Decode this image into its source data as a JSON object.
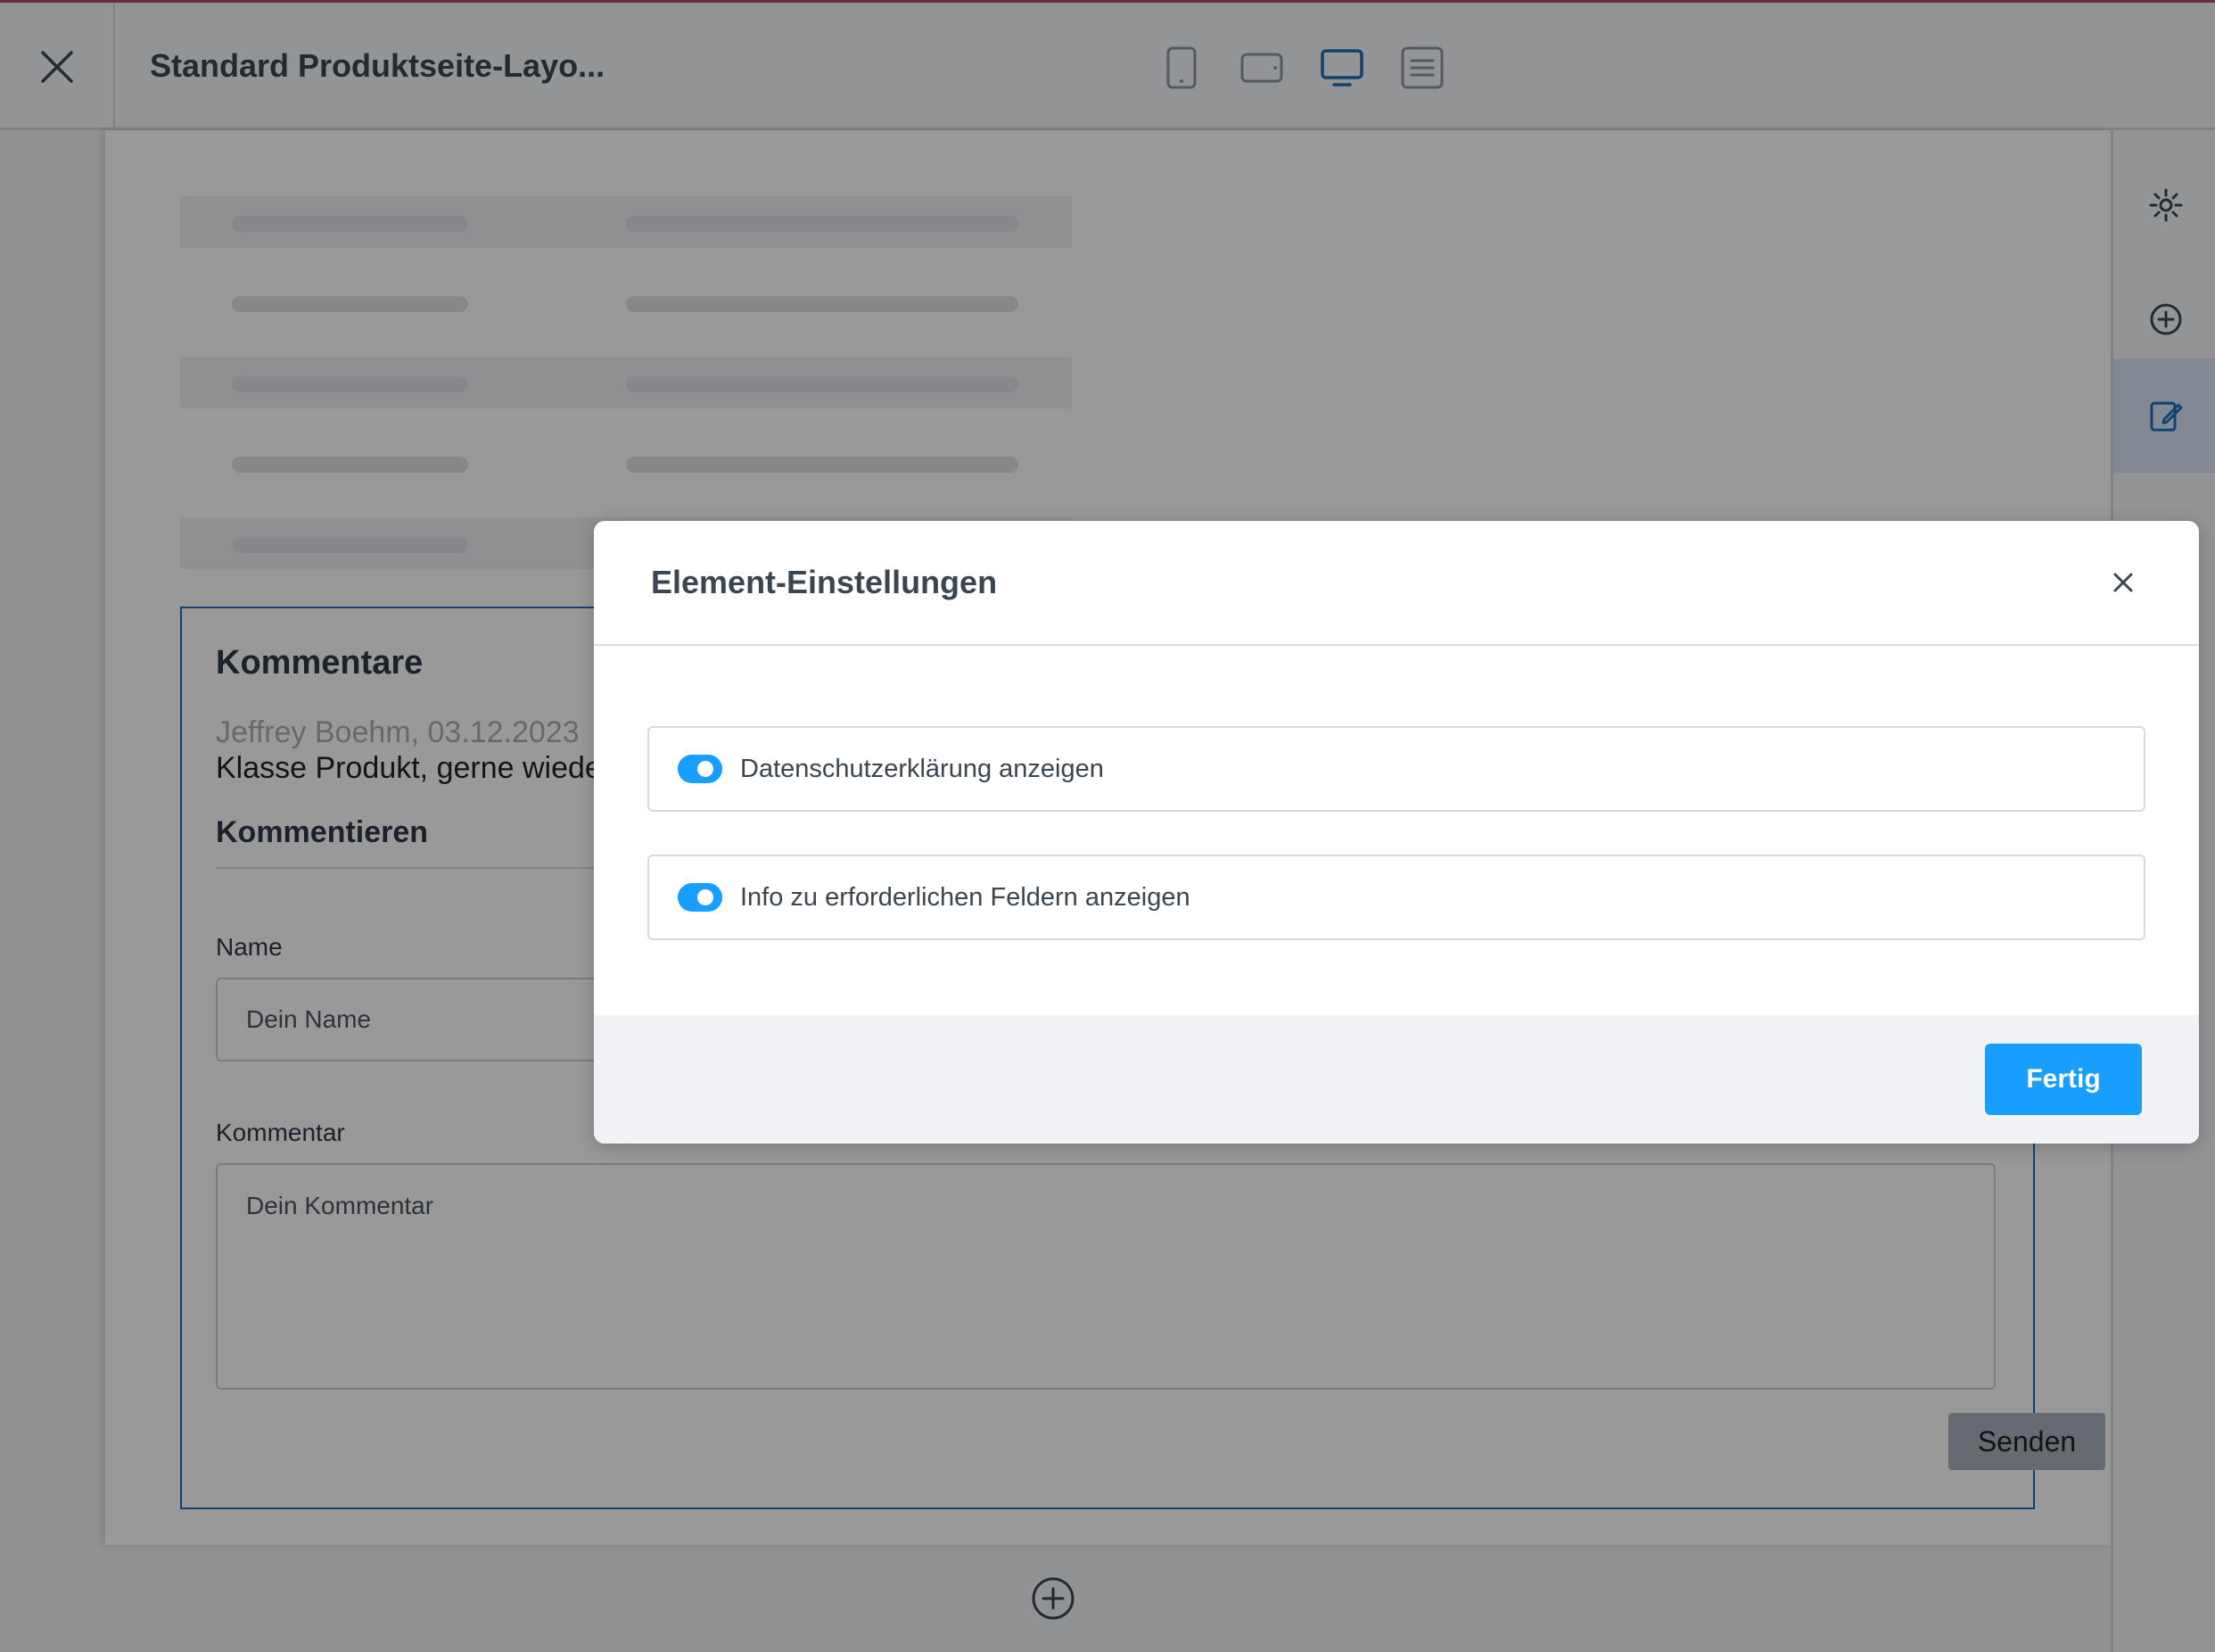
{
  "topbar": {
    "title": "Standard Produktseite-Layo..."
  },
  "view_modes": [
    "mobile",
    "tablet",
    "desktop",
    "list"
  ],
  "comments": {
    "title": "Kommentare",
    "meta": "Jeffrey Boehm, 03.12.2023",
    "text": "Klasse Produkt, gerne wiede",
    "subheading": "Kommentieren",
    "name_label": "Name",
    "name_placeholder": "Dein Name",
    "comment_label": "Kommentar",
    "comment_placeholder": "Dein Kommentar",
    "send_label": "Senden"
  },
  "sidebar": {
    "icons": [
      "gear-icon",
      "plus-circle-icon",
      "edit-icon"
    ],
    "active": "edit-icon"
  },
  "modal": {
    "title": "Element-Einstellungen",
    "options": [
      {
        "label": "Datenschutzerklärung anzeigen",
        "enabled": true
      },
      {
        "label": "Info zu erforderlichen Feldern anzeigen",
        "enabled": true
      }
    ],
    "done_label": "Fertig"
  },
  "colors": {
    "accent": "#189eff",
    "selection_border": "#1e6fbd",
    "active_sidebar_bg": "#d7e6f5"
  }
}
